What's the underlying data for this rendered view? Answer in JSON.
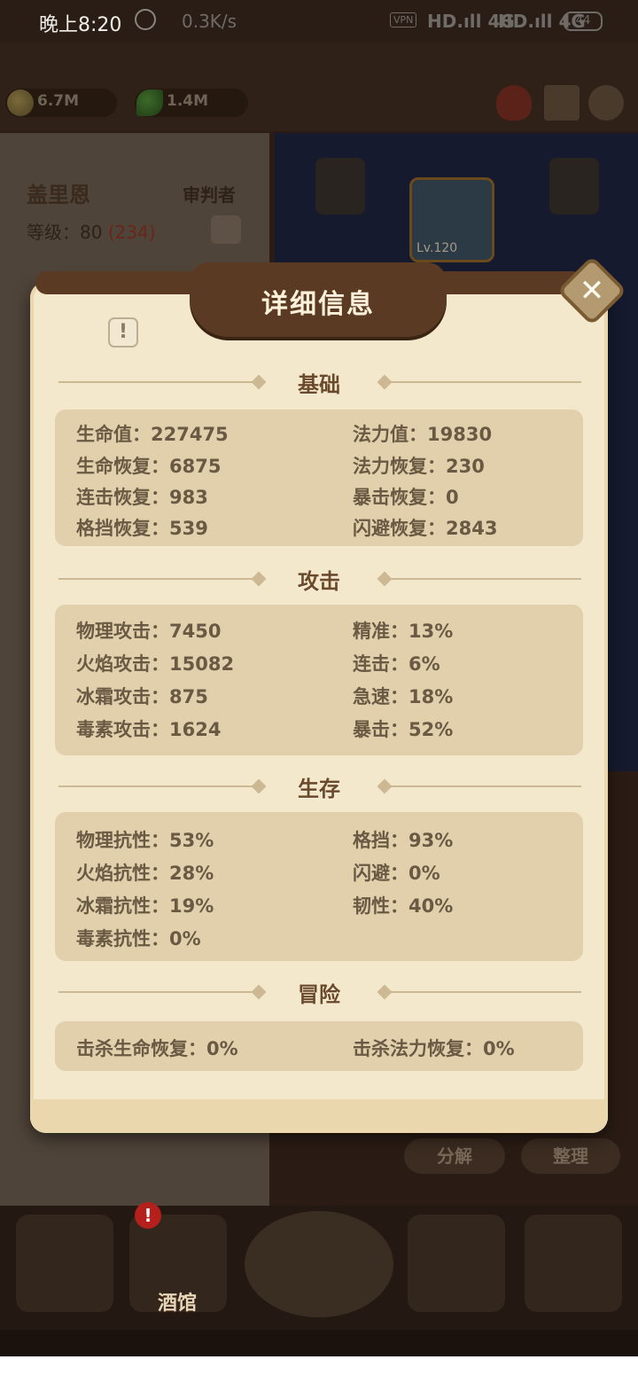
{
  "status_bar": {
    "time": "晚上8:20",
    "net_speed": "0.3K/s",
    "vpn": "VPN",
    "signal1": "HD.ıll 4G",
    "signal2": "HD.ıll 4G",
    "battery": "44"
  },
  "resources": {
    "gold": "6.7M",
    "leaf": "1.4M"
  },
  "hero": {
    "name": "盖里恩",
    "class": "审判者",
    "level": "等级：80",
    "level_extra": "(234)",
    "helmet_level": "Lv.120"
  },
  "bottom": {
    "decompose": "分解",
    "sort": "整理",
    "tavern": "酒馆",
    "tavern_alert": "!"
  },
  "dialog": {
    "title": "详细信息",
    "close": "✕",
    "info": "!",
    "sections": {
      "basic": {
        "title": "基础",
        "stats": [
          "生命值：227475",
          "法力值：19830",
          "生命恢复：6875",
          "法力恢复：230",
          "连击恢复：983",
          "暴击恢复：0",
          "格挡恢复：539",
          "闪避恢复：2843"
        ]
      },
      "attack": {
        "title": "攻击",
        "stats": [
          "物理攻击：7450",
          "精准：13%",
          "火焰攻击：15082",
          "连击：6%",
          "冰霜攻击：875",
          "急速：18%",
          "毒素攻击：1624",
          "暴击：52%"
        ]
      },
      "survival": {
        "title": "生存",
        "stats": [
          "物理抗性：53%",
          "格挡：93%",
          "火焰抗性：28%",
          "闪避：0%",
          "冰霜抗性：19%",
          "韧性：40%",
          "毒素抗性：0%"
        ]
      },
      "adventure": {
        "title": "冒险",
        "stats": [
          "击杀生命恢复：0%",
          "击杀法力恢复：0%"
        ]
      }
    }
  }
}
